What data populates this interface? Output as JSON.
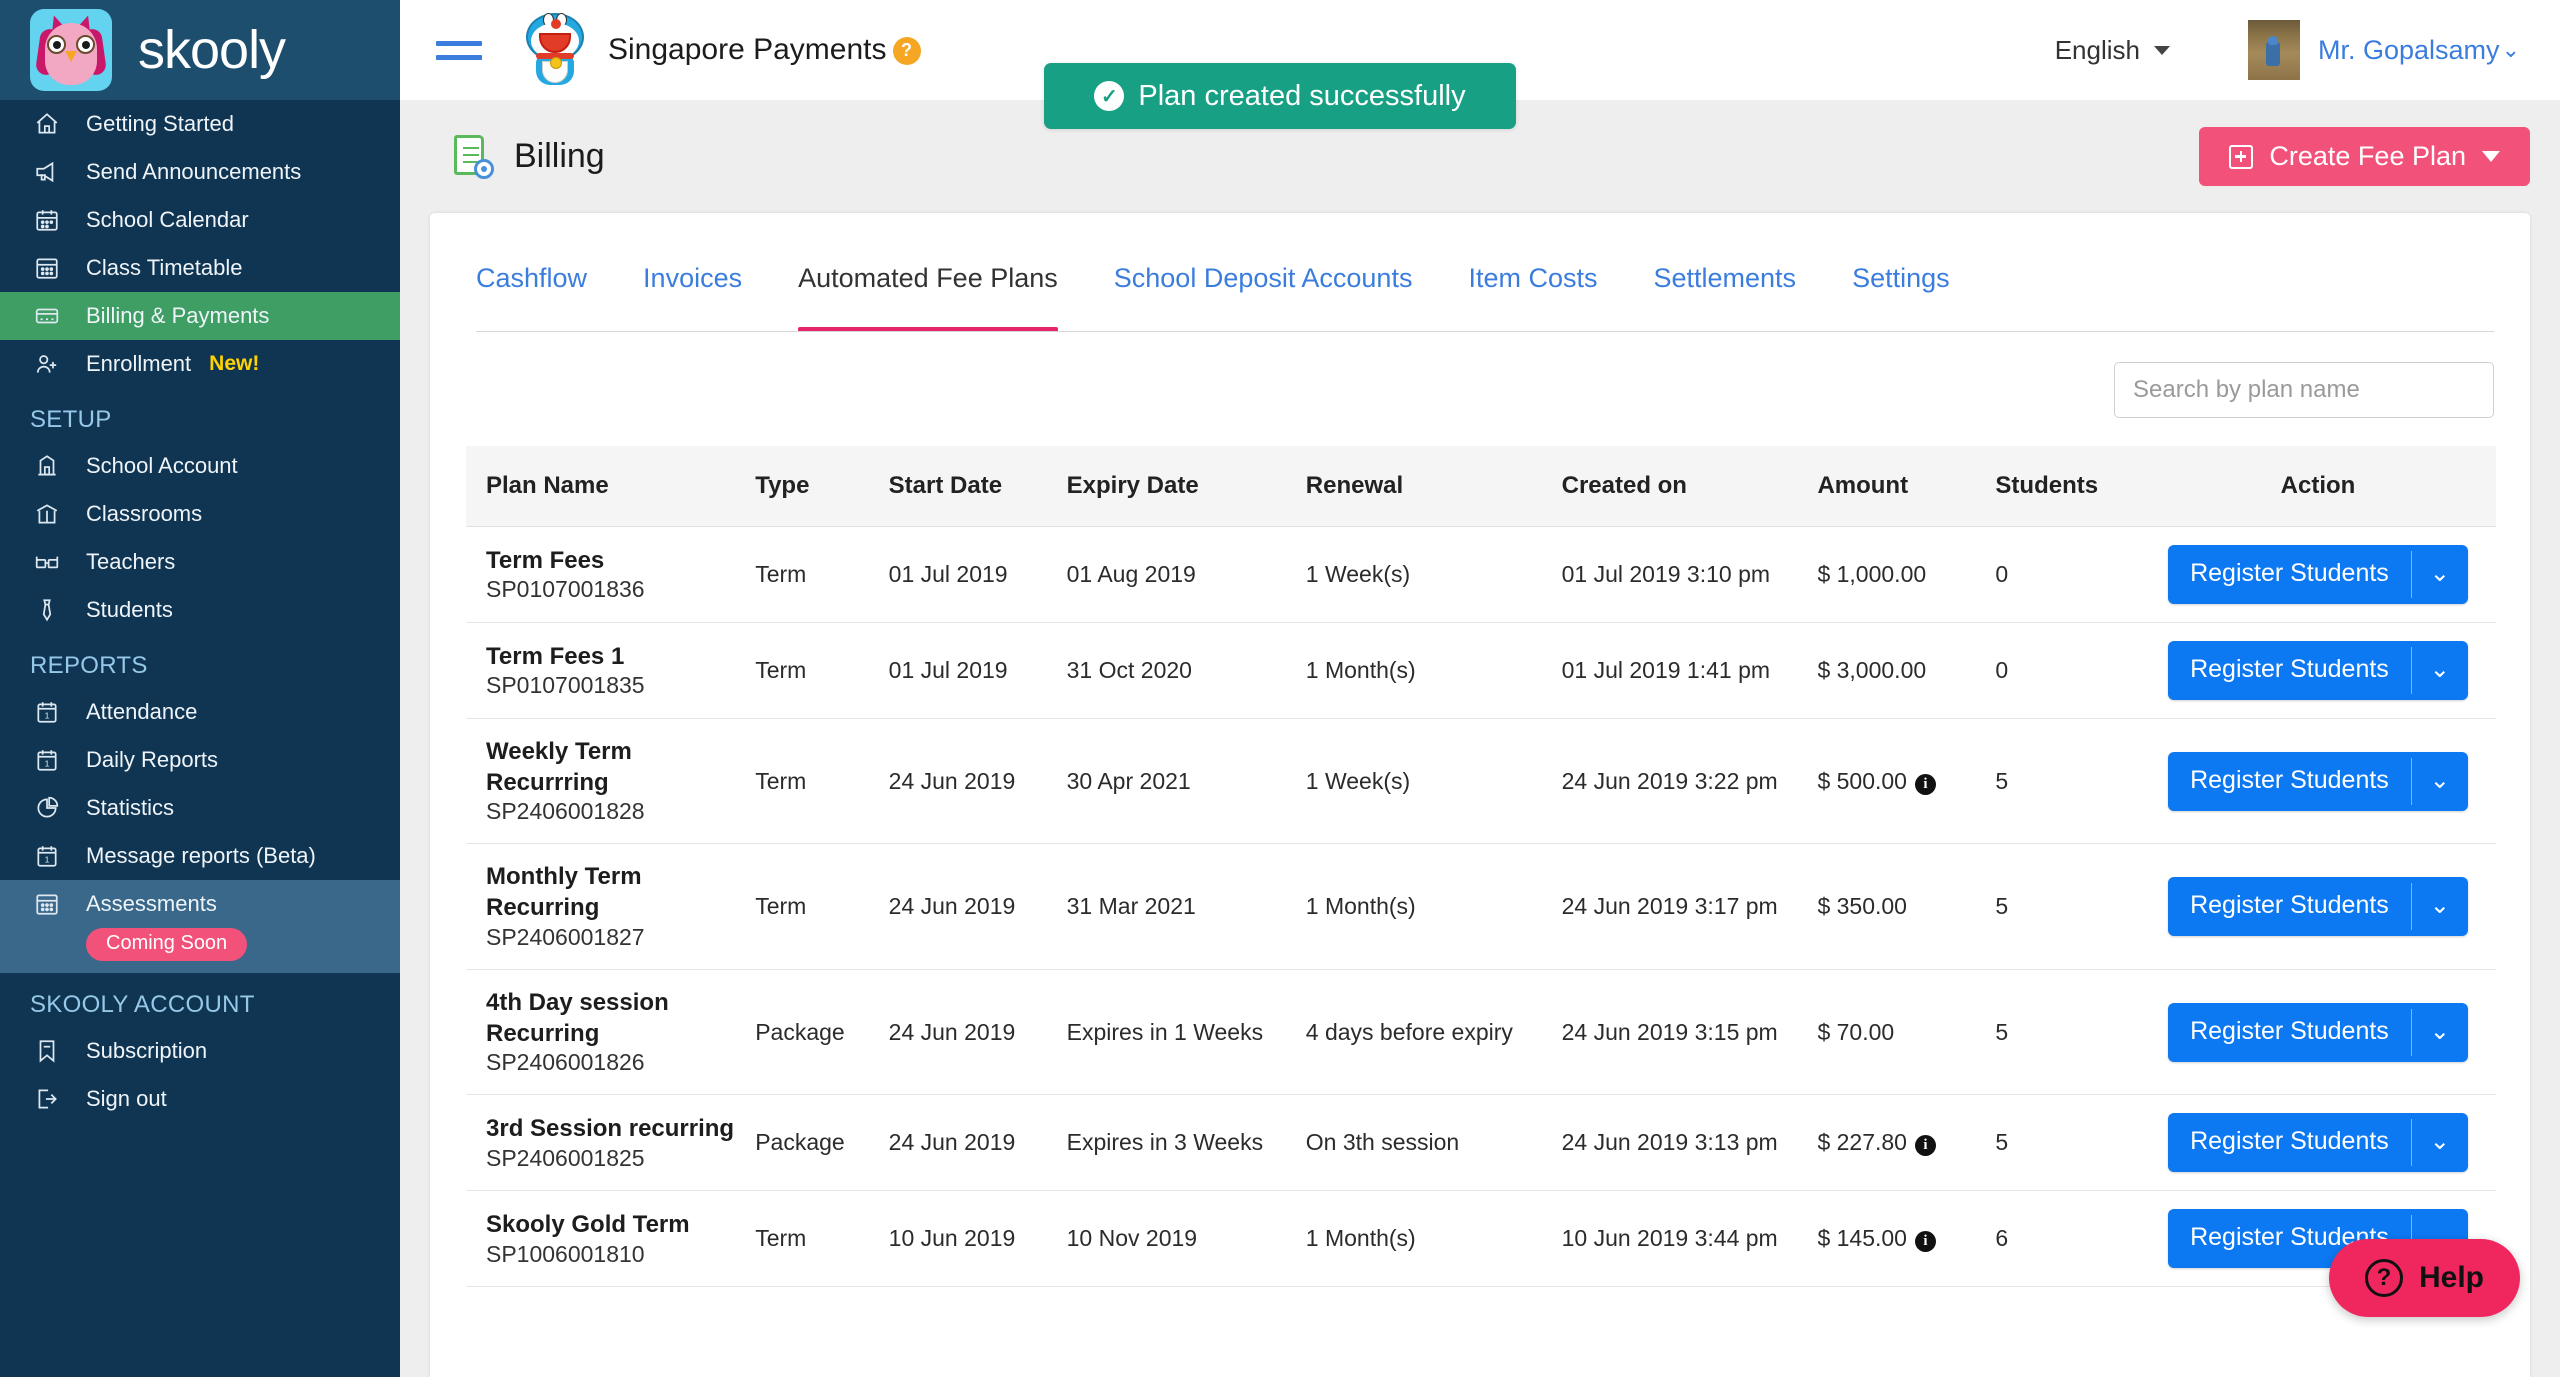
{
  "brand": {
    "name": "skooly",
    "logo_icon": "owl-logo-icon"
  },
  "sidebar": {
    "items": [
      {
        "label": "Getting Started",
        "icon": "home-icon"
      },
      {
        "label": "Send Announcements",
        "icon": "megaphone-icon"
      },
      {
        "label": "School Calendar",
        "icon": "calendar-icon"
      },
      {
        "label": "Class Timetable",
        "icon": "calendar-grid-icon"
      },
      {
        "label": "Billing & Payments",
        "icon": "card-icon",
        "state": "active"
      },
      {
        "label": "Enrollment",
        "icon": "user-plus-icon",
        "badge": "New!"
      }
    ],
    "setup_title": "SETUP",
    "setup_items": [
      {
        "label": "School Account",
        "icon": "school-icon"
      },
      {
        "label": "Classrooms",
        "icon": "classroom-icon"
      },
      {
        "label": "Teachers",
        "icon": "glasses-icon"
      },
      {
        "label": "Students",
        "icon": "tie-icon"
      }
    ],
    "reports_title": "REPORTS",
    "reports_items": [
      {
        "label": "Attendance",
        "icon": "calendar-one-icon"
      },
      {
        "label": "Daily Reports",
        "icon": "calendar-one-icon"
      },
      {
        "label": "Statistics",
        "icon": "pie-chart-icon"
      },
      {
        "label": "Message reports (Beta)",
        "icon": "calendar-one-icon"
      },
      {
        "label": "Assessments",
        "icon": "calendar-grid-icon",
        "state": "highlighted",
        "badge": "Coming Soon"
      }
    ],
    "account_title": "SKOOLY ACCOUNT",
    "account_items": [
      {
        "label": "Subscription",
        "icon": "bookmark-icon"
      },
      {
        "label": "Sign out",
        "icon": "logout-icon"
      }
    ]
  },
  "topbar": {
    "menu_icon": "hamburger-icon",
    "school_logo_icon": "doraemon-avatar-icon",
    "school_name": "Singapore Payments",
    "school_help_icon": "question-mark-icon",
    "language": "English",
    "language_caret_icon": "chevron-down-icon",
    "avatar_icon": "user-avatar-image",
    "username": "Mr. Gopalsamy",
    "username_caret_icon": "chevron-down-icon"
  },
  "toast": {
    "icon": "check-circle-icon",
    "message": "Plan created successfully",
    "color": "#18a085"
  },
  "page": {
    "icon": "billing-settings-icon",
    "title": "Billing",
    "create_button": {
      "label": "Create Fee Plan",
      "plus_icon": "plus-square-icon",
      "caret_icon": "caret-down-icon",
      "color": "#f2517a"
    }
  },
  "tabs": [
    {
      "label": "Cashflow",
      "selected": false
    },
    {
      "label": "Invoices",
      "selected": false
    },
    {
      "label": "Automated Fee Plans",
      "selected": true
    },
    {
      "label": "School Deposit Accounts",
      "selected": false
    },
    {
      "label": "Item Costs",
      "selected": false
    },
    {
      "label": "Settlements",
      "selected": false
    },
    {
      "label": "Settings",
      "selected": false
    }
  ],
  "search": {
    "placeholder": "Search by plan name",
    "value": ""
  },
  "table": {
    "columns": [
      "Plan Name",
      "Type",
      "Start Date",
      "Expiry Date",
      "Renewal",
      "Created on",
      "Amount",
      "Students",
      "Action"
    ],
    "action_button": {
      "label": "Register Students",
      "caret_icon": "chevron-down-icon",
      "color": "#0c78f2"
    },
    "info_icon": "info-icon",
    "rows": [
      {
        "plan_name": "Term Fees",
        "plan_code": "SP0107001836",
        "type": "Term",
        "start_date": "01 Jul 2019",
        "expiry_date": "01 Aug 2019",
        "renewal": "1 Week(s)",
        "created_on": "01 Jul 2019 3:10 pm",
        "amount": "$ 1,000.00",
        "has_info": false,
        "students": "0"
      },
      {
        "plan_name": "Term Fees 1",
        "plan_code": "SP0107001835",
        "type": "Term",
        "start_date": "01 Jul 2019",
        "expiry_date": "31 Oct 2020",
        "renewal": "1 Month(s)",
        "created_on": "01 Jul 2019 1:41 pm",
        "amount": "$ 3,000.00",
        "has_info": false,
        "students": "0"
      },
      {
        "plan_name": "Weekly Term Recurrring",
        "plan_code": "SP2406001828",
        "type": "Term",
        "start_date": "24 Jun 2019",
        "expiry_date": "30 Apr 2021",
        "renewal": "1 Week(s)",
        "created_on": "24 Jun 2019 3:22 pm",
        "amount": "$ 500.00",
        "has_info": true,
        "students": "5"
      },
      {
        "plan_name": "Monthly Term Recurring",
        "plan_code": "SP2406001827",
        "type": "Term",
        "start_date": "24 Jun 2019",
        "expiry_date": "31 Mar 2021",
        "renewal": "1 Month(s)",
        "created_on": "24 Jun 2019 3:17 pm",
        "amount": "$ 350.00",
        "has_info": false,
        "students": "5"
      },
      {
        "plan_name": "4th Day session Recurring",
        "plan_code": "SP2406001826",
        "type": "Package",
        "start_date": "24 Jun 2019",
        "expiry_date": "Expires in 1 Weeks",
        "renewal": "4 days before expiry",
        "created_on": "24 Jun 2019 3:15 pm",
        "amount": "$ 70.00",
        "has_info": false,
        "students": "5"
      },
      {
        "plan_name": "3rd Session recurring",
        "plan_code": "SP2406001825",
        "type": "Package",
        "start_date": "24 Jun 2019",
        "expiry_date": "Expires in 3 Weeks",
        "renewal": "On 3th session",
        "created_on": "24 Jun 2019 3:13 pm",
        "amount": "$ 227.80",
        "has_info": true,
        "students": "5"
      },
      {
        "plan_name": "Skooly Gold Term",
        "plan_code": "SP1006001810",
        "type": "Term",
        "start_date": "10 Jun 2019",
        "expiry_date": "10 Nov 2019",
        "renewal": "1 Month(s)",
        "created_on": "10 Jun 2019 3:44 pm",
        "amount": "$ 145.00",
        "has_info": true,
        "students": "6"
      }
    ]
  },
  "help_widget": {
    "label": "Help",
    "icon": "question-circle-icon",
    "color": "#f0275f"
  }
}
